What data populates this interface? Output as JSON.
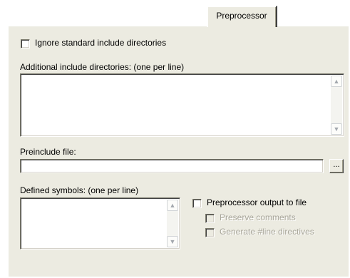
{
  "tab": {
    "label": "Preprocessor"
  },
  "ignore_std": {
    "label": "Ignore standard include directories",
    "checked": false
  },
  "include_dirs": {
    "label": "Additional include directories: (one per line)",
    "value": ""
  },
  "preinclude": {
    "label": "Preinclude file:",
    "value": "",
    "browse_label": "..."
  },
  "defined_symbols": {
    "label": "Defined symbols: (one per line)",
    "value": ""
  },
  "pp_output": {
    "label": "Preprocessor output to file",
    "checked": false
  },
  "preserve_comments": {
    "label": "Preserve comments",
    "enabled": false
  },
  "line_directives": {
    "label": "Generate #line directives",
    "enabled": false
  },
  "icons": {
    "scroll_up": "scroll-up-arrow",
    "scroll_down": "scroll-down-arrow"
  }
}
